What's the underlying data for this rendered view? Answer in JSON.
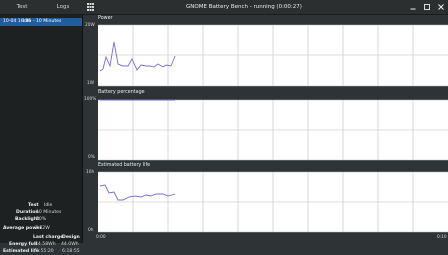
{
  "header": {
    "tabs": [
      "Test",
      "Logs"
    ],
    "window_title": "GNOME Battery Bench - running (0:00:27)"
  },
  "sidebar": {
    "run": {
      "date": "10-04 16:36",
      "title": "Idle - 10 Minutes"
    },
    "stats": {
      "test_label": "Test",
      "test_value": "Idle",
      "duration_label": "Duration",
      "duration_value": "10 Minutes",
      "backlight_label": "Backlight",
      "backlight_value": "50%",
      "avg_power_label": "Average power",
      "avg_power_value": "7.52W",
      "col_last_charge": "Last charge",
      "col_design": "Design",
      "energy_full_label": "Energy full",
      "energy_full_last": "44.58Wh",
      "energy_full_design": "44.0Wh",
      "est_life_label": "Estimated life",
      "est_life_last": "5:55:20",
      "est_life_design": "6:18:55"
    }
  },
  "plots": {
    "x_ticks": [
      "0:00",
      "0:10"
    ],
    "power": {
      "title": "Power",
      "y_top": "20W",
      "y_bottom": "1W"
    },
    "battery": {
      "title": "Battery percentage",
      "y_top": "100%",
      "y_bottom": "0%"
    },
    "life": {
      "title": "Estimated battery life",
      "y_top": "10h",
      "y_bottom": "0h"
    }
  },
  "colors": {
    "line": "#6f6fd8",
    "selection": "#215d9c",
    "grid": "#bdbdbd"
  }
}
